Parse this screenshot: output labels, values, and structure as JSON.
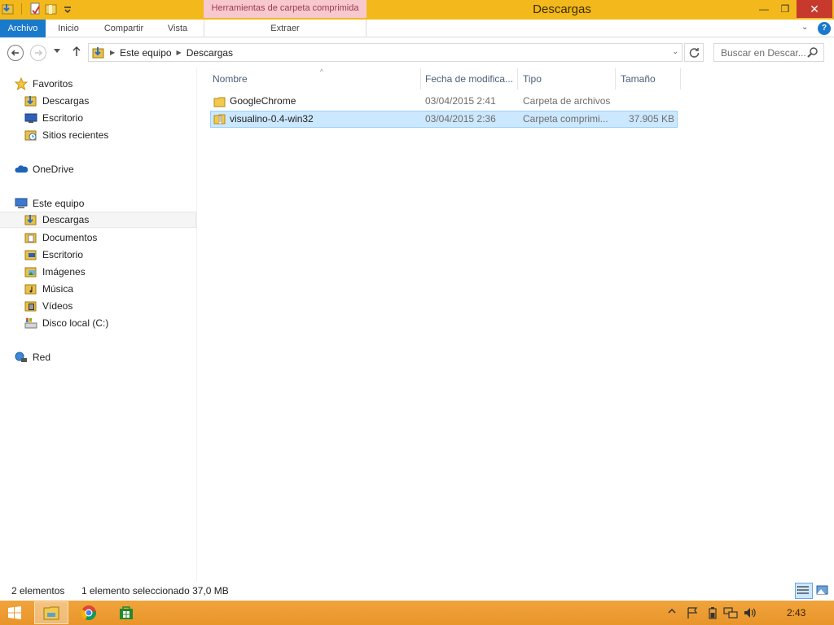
{
  "window": {
    "title": "Descargas",
    "context_tab_group": "Herramientas de carpeta comprimida",
    "minimize": "—",
    "maximize": "❐",
    "close": "✕"
  },
  "ribbon": {
    "tabs": [
      "Archivo",
      "Inicio",
      "Compartir",
      "Vista",
      "Extraer"
    ],
    "expand_glyph": "⌄",
    "help_glyph": "?"
  },
  "address": {
    "crumbs": [
      "Este equipo",
      "Descargas"
    ],
    "search_placeholder": "Buscar en Descar..."
  },
  "nav": {
    "favorites": {
      "label": "Favoritos",
      "items": [
        "Descargas",
        "Escritorio",
        "Sitios recientes"
      ]
    },
    "onedrive": "OneDrive",
    "thispc": {
      "label": "Este equipo",
      "items": [
        "Descargas",
        "Documentos",
        "Escritorio",
        "Imágenes",
        "Música",
        "Vídeos",
        "Disco local (C:)"
      ]
    },
    "network": "Red"
  },
  "columns": {
    "name": "Nombre",
    "date": "Fecha de modifica...",
    "type": "Tipo",
    "size": "Tamaño"
  },
  "files": [
    {
      "name": "GoogleChrome",
      "date": "03/04/2015 2:41",
      "type": "Carpeta de archivos",
      "size": "",
      "icon": "folder-icon",
      "selected": false
    },
    {
      "name": "visualino-0.4-win32",
      "date": "03/04/2015 2:36",
      "type": "Carpeta comprimi...",
      "size": "37.905 KB",
      "icon": "zip-folder-icon",
      "selected": true
    }
  ],
  "status": {
    "count": "2 elementos",
    "selection": "1 elemento seleccionado  37,0 MB"
  },
  "taskbar": {
    "apps": [
      "file-explorer-icon",
      "chrome-icon",
      "store-icon"
    ],
    "clock": "2:43"
  },
  "colors": {
    "titlebar": "#f3b81b",
    "accent": "#1979ca",
    "selection": "#cce8ff",
    "taskbar": "#eca038"
  }
}
